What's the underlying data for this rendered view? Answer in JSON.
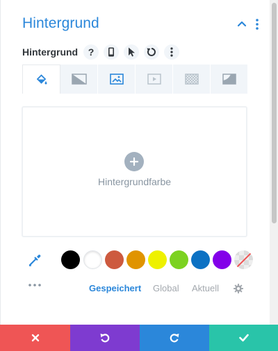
{
  "section": {
    "title": "Hintergrund"
  },
  "field": {
    "label": "Hintergrund"
  },
  "background_tabs": [
    {
      "name": "color",
      "icon": "paint-bucket-icon",
      "active": true
    },
    {
      "name": "gradient",
      "icon": "gradient-icon",
      "active": false
    },
    {
      "name": "image",
      "icon": "image-icon",
      "active": false
    },
    {
      "name": "video",
      "icon": "video-icon",
      "active": false
    },
    {
      "name": "pattern",
      "icon": "pattern-icon",
      "active": false
    },
    {
      "name": "mask",
      "icon": "mask-icon",
      "active": false
    }
  ],
  "preview": {
    "label": "Hintergrundfarbe"
  },
  "palette": {
    "colors": [
      "#000000",
      "#ffffff",
      "#cd5a3f",
      "#e09400",
      "#eef100",
      "#7cd221",
      "#0c71c3",
      "#8300e9"
    ],
    "tabs": [
      {
        "label": "Gespeichert",
        "active": true
      },
      {
        "label": "Global",
        "active": false
      },
      {
        "label": "Aktuell",
        "active": false
      }
    ]
  },
  "colors": {
    "accent": "#2b87da",
    "cancel": "#ef5555",
    "undo": "#7e3bd0",
    "redo": "#2b87da",
    "save": "#29c4a9"
  }
}
